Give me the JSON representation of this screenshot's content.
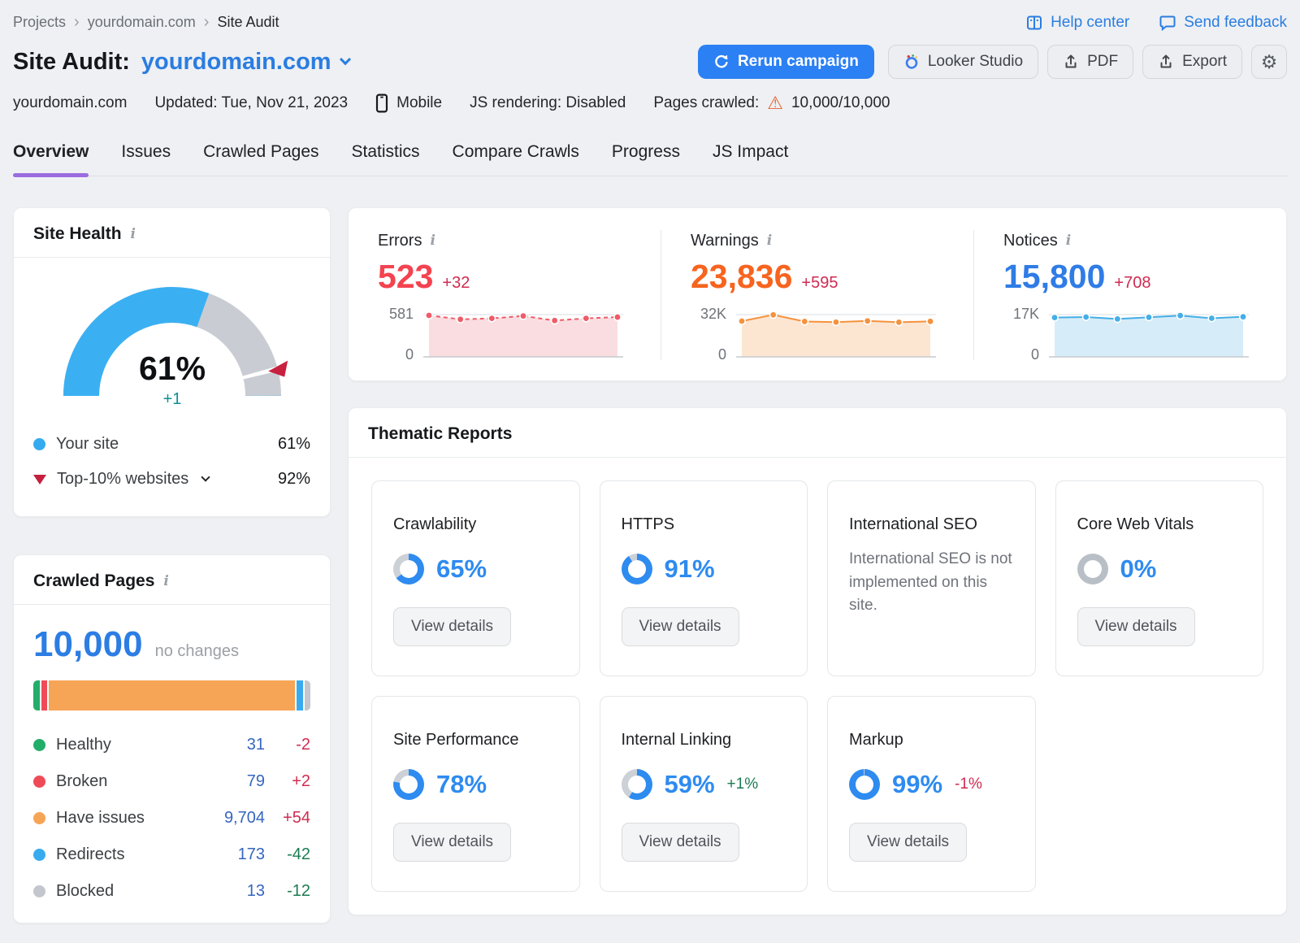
{
  "colors": {
    "accent_blue": "#2b80f4",
    "link_blue": "#2a7de1",
    "tab_underline_purple": "#9b6ce0",
    "error_red": "#f44350",
    "warning_orange": "#f7641f",
    "notice_blue": "#2f7ce6",
    "change_red": "#cf2b50",
    "change_green": "#1c7c52",
    "health_delta_teal": "#0f8f94",
    "gauge_blue": "#3ab0f2",
    "gauge_gray": "#c9cdd3",
    "benchmark_marker_red": "#c8203f",
    "donut_blue": "#2e8bf0",
    "donut_gray": "#ccd1d7",
    "healthy_green": "#23ad6b",
    "broken_red": "#ef4b57",
    "issues_orange": "#f6a456",
    "redirects_blue": "#38abef",
    "blocked_gray": "#c3c7cd"
  },
  "breadcrumb": {
    "items": [
      "Projects",
      "yourdomain.com",
      "Site Audit"
    ],
    "separator": "›"
  },
  "header": {
    "help_center": "Help center",
    "send_feedback": "Send feedback",
    "title_prefix": "Site Audit:",
    "domain": "yourdomain.com",
    "rerun": "Rerun campaign",
    "looker": "Looker Studio",
    "pdf": "PDF",
    "export": "Export"
  },
  "meta": {
    "domain": "yourdomain.com",
    "updated": "Updated: Tue, Nov 21, 2023",
    "device": "Mobile",
    "js_rendering": "JS rendering: Disabled",
    "crawled_label": "Pages crawled:",
    "crawled_value": "10,000/10,000"
  },
  "tabs": [
    "Overview",
    "Issues",
    "Crawled Pages",
    "Statistics",
    "Compare Crawls",
    "Progress",
    "JS Impact"
  ],
  "site_health": {
    "title": "Site Health",
    "score": "61%",
    "change": "+1",
    "your_site_label": "Your site",
    "your_site_value": "61%",
    "top10_label": "Top-10% websites",
    "top10_value": "92%"
  },
  "summary": {
    "errors": {
      "title": "Errors",
      "value": "523",
      "change": "+32",
      "y_top": "581",
      "y_bottom": "0"
    },
    "warnings": {
      "title": "Warnings",
      "value": "23,836",
      "change": "+595",
      "y_top": "32K",
      "y_bottom": "0"
    },
    "notices": {
      "title": "Notices",
      "value": "15,800",
      "change": "+708",
      "y_top": "17K",
      "y_bottom": "0"
    }
  },
  "crawled_pages": {
    "title": "Crawled Pages",
    "total": "10,000",
    "note": "no changes",
    "legend": [
      {
        "label": "Healthy",
        "value": "31",
        "change": "-2"
      },
      {
        "label": "Broken",
        "value": "79",
        "change": "+2"
      },
      {
        "label": "Have issues",
        "value": "9,704",
        "change": "+54"
      },
      {
        "label": "Redirects",
        "value": "173",
        "change": "-42"
      },
      {
        "label": "Blocked",
        "value": "13",
        "change": "-12"
      }
    ]
  },
  "thematic": {
    "title": "Thematic Reports",
    "button": "View details",
    "cards": [
      {
        "title": "Crawlability",
        "percent": 65,
        "percent_label": "65%"
      },
      {
        "title": "HTTPS",
        "percent": 91,
        "percent_label": "91%"
      },
      {
        "title": "International SEO",
        "description": "International SEO is not implemented on this site."
      },
      {
        "title": "Core Web Vitals",
        "percent": 0,
        "percent_label": "0%"
      },
      {
        "title": "Site Performance",
        "percent": 78,
        "percent_label": "78%"
      },
      {
        "title": "Internal Linking",
        "percent": 59,
        "percent_label": "59%",
        "change": "+1%"
      },
      {
        "title": "Markup",
        "percent": 99,
        "percent_label": "99%",
        "change": "-1%"
      }
    ]
  },
  "chart_data": [
    {
      "type": "gauge",
      "title": "Site Health",
      "value": 61,
      "benchmark": 92,
      "range": [
        0,
        100
      ],
      "legend": [
        {
          "label": "Your site",
          "value": 61
        },
        {
          "label": "Top-10% websites",
          "value": 92
        }
      ]
    },
    {
      "type": "area",
      "title": "Errors over last 7 crawls",
      "ylim": [
        0,
        581
      ],
      "x": [
        1,
        2,
        3,
        4,
        5,
        6,
        7
      ],
      "values": [
        570,
        515,
        528,
        562,
        498,
        528,
        546
      ],
      "line": "#ef5b68",
      "fill": "#fadde0",
      "dashed": true
    },
    {
      "type": "area",
      "title": "Warnings over last 7 crawls",
      "ylim": [
        0,
        32000
      ],
      "x": [
        1,
        2,
        3,
        4,
        5,
        6,
        7
      ],
      "values": [
        27000,
        31800,
        26700,
        26200,
        27100,
        26100,
        26800
      ],
      "line": "#f5923e",
      "fill": "#fce6d2",
      "dashed": false
    },
    {
      "type": "area",
      "title": "Notices over last 7 crawls",
      "ylim": [
        0,
        17000
      ],
      "x": [
        1,
        2,
        3,
        4,
        5,
        6,
        7
      ],
      "values": [
        15800,
        16000,
        15200,
        15900,
        16600,
        15500,
        16100
      ],
      "line": "#45aee6",
      "fill": "#d6ecf8",
      "dashed": false
    },
    {
      "type": "bar",
      "title": "Crawled pages breakdown",
      "categories": [
        "Healthy",
        "Broken",
        "Have issues",
        "Redirects",
        "Blocked"
      ],
      "values": [
        31,
        79,
        9704,
        173,
        13
      ],
      "colors": [
        "#23ad6b",
        "#ef4b57",
        "#f6a456",
        "#38abef",
        "#c3c7cd"
      ],
      "total": 10000
    },
    {
      "type": "donut",
      "title": "Thematic report scores",
      "categories": [
        "Crawlability",
        "HTTPS",
        "Core Web Vitals",
        "Site Performance",
        "Internal Linking",
        "Markup"
      ],
      "values": [
        65,
        91,
        0,
        78,
        59,
        99
      ]
    }
  ]
}
